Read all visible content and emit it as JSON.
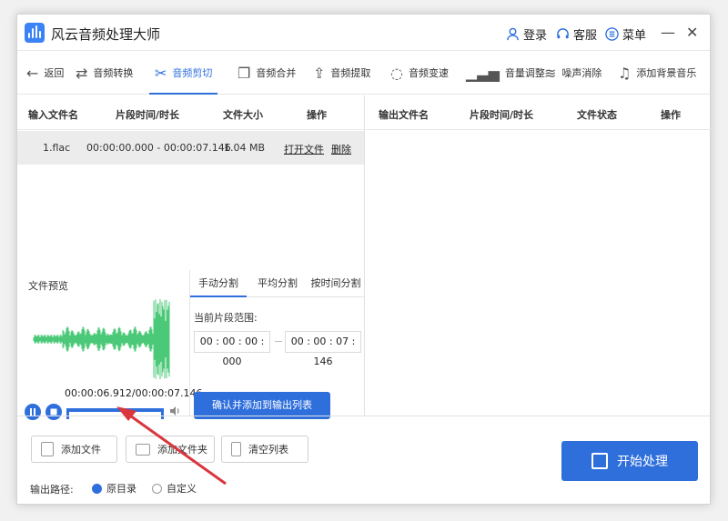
{
  "app": {
    "title": "风云音频处理大师"
  },
  "titlebar": {
    "login": "登录",
    "service": "客服",
    "menu": "菜单",
    "minimize": "—",
    "close": "✕"
  },
  "toolbar": {
    "back": "返回",
    "items": [
      "音频转换",
      "音频剪切",
      "音频合并",
      "音频提取",
      "音频变速",
      "音量调整",
      "噪声消除",
      "添加背景音乐"
    ],
    "active": "音频剪切"
  },
  "input_table": {
    "headers": [
      "输入文件名",
      "片段时间/时长",
      "文件大小",
      "操作"
    ],
    "rows": [
      {
        "name": "1.flac",
        "duration": "00:00:00.000 - 00:00:07.146",
        "size": "1.04 MB",
        "open": "打开文件",
        "delete": "删除"
      }
    ]
  },
  "output_table": {
    "headers": [
      "输出文件名",
      "片段时间/时长",
      "文件状态",
      "操作"
    ]
  },
  "preview": {
    "label": "文件预览",
    "time_display": "00:00:06.912/00:00:07.146",
    "progress": 0.97
  },
  "split_tabs": {
    "items": [
      "手动分割",
      "平均分割",
      "按时间分割"
    ],
    "active": "手动分割",
    "range_label": "当前片段范围:",
    "start_time": "00 : 00 : 00 : 000",
    "end_time": "00 : 00 : 07 : 146",
    "confirm_button": "确认并添加到输出列表"
  },
  "bottom": {
    "add_file": "添加文件",
    "add_folder": "添加文件夹",
    "clear_list": "清空列表",
    "output_path_label": "输出路径:",
    "option_original": "原目录",
    "option_custom": "自定义",
    "start_button": "开始处理"
  },
  "colors": {
    "accent": "#2f6fdc",
    "wave": "#4cc978",
    "arrow": "#d9363e"
  }
}
